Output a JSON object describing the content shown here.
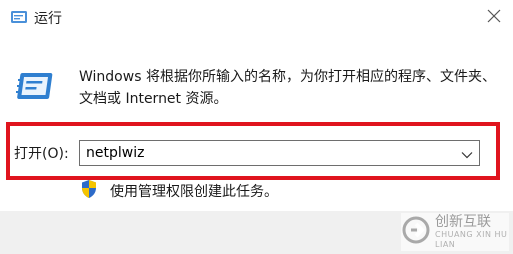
{
  "window": {
    "title": "运行",
    "close_icon": "close-icon"
  },
  "body": {
    "description": "Windows 将根据你所输入的名称，为你打开相应的程序、文件夹、文档或 Internet 资源。",
    "run_icon": "run-app-icon"
  },
  "open": {
    "label": "打开(O):",
    "value": "netplwiz",
    "dropdown_icon": "chevron-down-icon",
    "highlight_color": "#e0141e"
  },
  "admin_note": {
    "text": "使用管理权限创建此任务。",
    "icon": "uac-shield-icon"
  },
  "watermark": {
    "name": "创新互联",
    "sub": "CHUANG XIN HU LIAN"
  }
}
